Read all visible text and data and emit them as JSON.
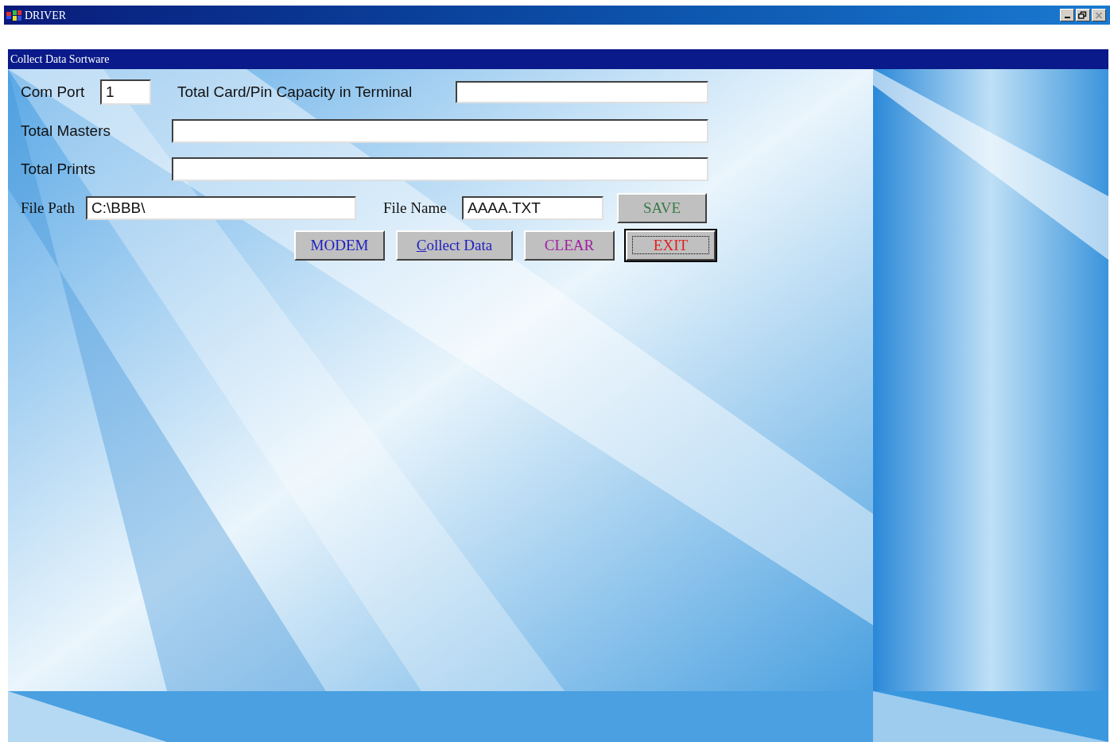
{
  "window": {
    "title": "DRIVER",
    "controls": [
      {
        "kind": "minimize"
      },
      {
        "kind": "restore"
      },
      {
        "kind": "close"
      }
    ]
  },
  "form": {
    "title": "Collect Data Sortware",
    "com_port": {
      "label": "Com Port",
      "value": "1"
    },
    "capacity": {
      "label": "Total Card/Pin Capacity in Terminal"
    },
    "masters": {
      "label": "Total Masters"
    },
    "prints": {
      "label": "Total Prints"
    },
    "file_path": {
      "label": "File Path",
      "value": "C:\\BBB\\"
    },
    "file_name": {
      "label": "File Name",
      "value": "AAAA.TXT"
    },
    "buttons": [
      {
        "label": "SAVE",
        "color": "#3a7a4a",
        "focused": false,
        "mnemonic": false
      },
      {
        "label": "MODEM",
        "color": "#2020c0",
        "focused": false,
        "mnemonic": false
      },
      {
        "label": "Collect Data",
        "color": "#2020c0",
        "focused": false,
        "mnemonic": true
      },
      {
        "label": "CLEAR",
        "color": "#a020a0",
        "focused": false,
        "mnemonic": false
      },
      {
        "label": "EXIT",
        "color": "#e02020",
        "focused": true,
        "mnemonic": false
      }
    ]
  }
}
